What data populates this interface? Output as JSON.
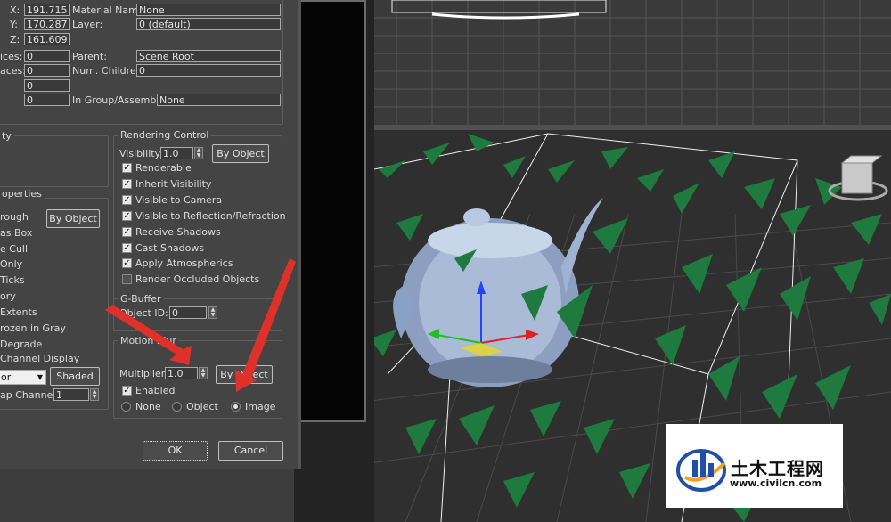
{
  "object_info": {
    "x_label": "X:",
    "x_value": "191.715",
    "y_label": "Y:",
    "y_value": "170.287",
    "z_label": "Z:",
    "z_value": "161.609",
    "vertices_label": "ices:",
    "vertices_value": "0",
    "faces_label": "aces:",
    "faces_value": "0",
    "extra_value_1": "0",
    "extra_value_2": "0",
    "material_name_label": "Material Name:",
    "material_name_value": "None",
    "layer_label": "Layer:",
    "layer_value": "0 (default)",
    "parent_label": "Parent:",
    "parent_value": "Scene Root",
    "num_children_label": "Num. Children:",
    "num_children_value": "0",
    "in_group_label": "In Group/Assembly:",
    "in_group_value": "None"
  },
  "interactivity": {
    "title": "ty"
  },
  "display_properties": {
    "title": "operties",
    "items": [
      "rough",
      "as Box",
      "e Cull",
      "Only",
      "Ticks",
      "ory",
      "Extents",
      "rozen in Gray",
      "Degrade",
      "Channel Display"
    ],
    "by_object_label": "By Object",
    "color_select_value": "or",
    "shaded_label": "Shaded",
    "map_channel_label": "ap Channel:",
    "map_channel_value": "1"
  },
  "rendering_control": {
    "title": "Rendering Control",
    "visibility_label": "Visibility:",
    "visibility_value": "1.0",
    "by_object_label": "By Object",
    "checkboxes": [
      {
        "label": "Renderable",
        "checked": true
      },
      {
        "label": "Inherit Visibility",
        "checked": true
      },
      {
        "label": "Visible to Camera",
        "checked": true
      },
      {
        "label": "Visible to Reflection/Refraction",
        "checked": true
      },
      {
        "label": "Receive Shadows",
        "checked": true
      },
      {
        "label": "Cast Shadows",
        "checked": true
      },
      {
        "label": "Apply Atmospherics",
        "checked": true
      },
      {
        "label": "Render Occluded Objects",
        "checked": false
      }
    ]
  },
  "gbuffer": {
    "title": "G-Buffer",
    "object_id_label": "Object ID:",
    "object_id_value": "0"
  },
  "motion_blur": {
    "title": "Motion Blur",
    "multiplier_label": "Multiplier:",
    "multiplier_value": "1.0",
    "by_object_label": "By Object",
    "enabled_label": "Enabled",
    "enabled_checked": true,
    "radio_none": "None",
    "radio_object": "Object",
    "radio_image": "Image",
    "selected": "Image"
  },
  "buttons": {
    "ok": "OK",
    "cancel": "Cancel"
  },
  "watermark": {
    "brand_text": "土木工程网",
    "url_text": "www.civilcn.com"
  },
  "colors": {
    "dialog_bg": "#444444",
    "viewport_bg": "#2f2f2f",
    "leaf_green": "#1e7a3e",
    "arrow_red": "#e0302a",
    "logo_blue": "#1f4fa8"
  }
}
